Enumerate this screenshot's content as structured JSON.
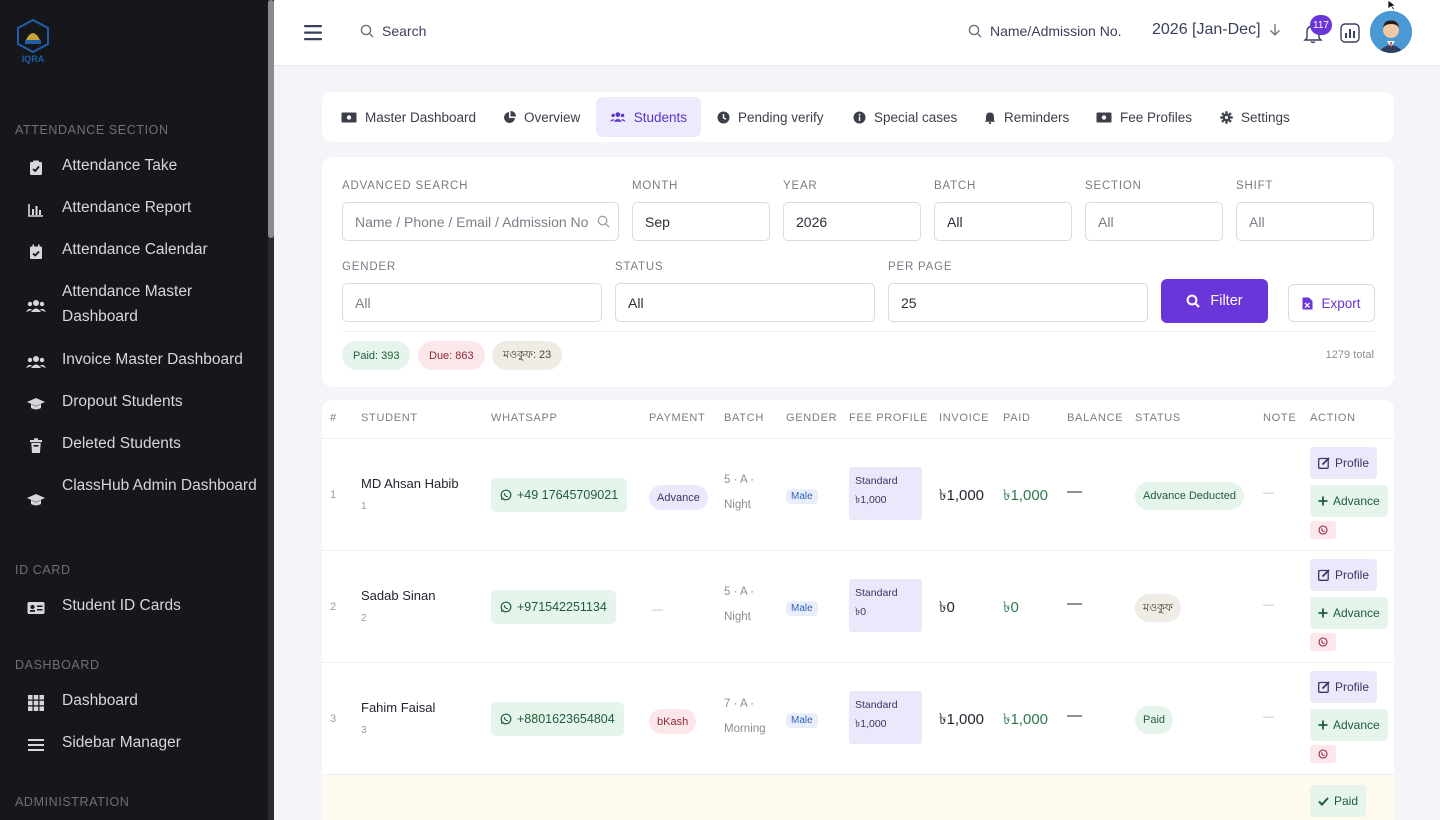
{
  "sidebar": {
    "logo_text": "IQRA",
    "sections": [
      {
        "title": "ATTENDANCE SECTION"
      },
      {
        "title": "ID CARD"
      },
      {
        "title": "DASHBOARD"
      },
      {
        "title": "ADMINISTRATION"
      }
    ],
    "items": [
      {
        "label": "Attendance Take",
        "icon": "clipboard-check-icon"
      },
      {
        "label": "Attendance Report",
        "icon": "bar-chart-icon"
      },
      {
        "label": "Attendance Calendar",
        "icon": "calendar-check-icon"
      },
      {
        "label": "Attendance Master Dashboard",
        "icon": "users-icon"
      },
      {
        "label": "Invoice Master Dashboard",
        "icon": "users-icon"
      },
      {
        "label": "Dropout Students",
        "icon": "graduation-cap-icon"
      },
      {
        "label": "Deleted Students",
        "icon": "trash-icon"
      },
      {
        "label": "ClassHub Admin Dashboard",
        "icon": "graduation-cap-icon"
      },
      {
        "label": "Student ID Cards",
        "icon": "id-card-icon"
      },
      {
        "label": "Dashboard",
        "icon": "grid-icon"
      },
      {
        "label": "Sidebar Manager",
        "icon": "list-icon"
      }
    ]
  },
  "header": {
    "search_label": "Search",
    "name_search_label": "Name/Admission No.",
    "year": "2026 [Jan-Dec]",
    "notification_count": "117"
  },
  "tabs": [
    {
      "label": "Master Dashboard",
      "icon": "money-icon"
    },
    {
      "label": "Overview",
      "icon": "pie-chart-icon"
    },
    {
      "label": "Students",
      "icon": "users-icon",
      "active": true
    },
    {
      "label": "Pending verify",
      "icon": "clock-icon"
    },
    {
      "label": "Special cases",
      "icon": "info-icon"
    },
    {
      "label": "Reminders",
      "icon": "bell-icon"
    },
    {
      "label": "Fee Profiles",
      "icon": "money-icon"
    },
    {
      "label": "Settings",
      "icon": "gear-icon"
    }
  ],
  "filters": {
    "advanced_search_label": "ADVANCED SEARCH",
    "advanced_search_placeholder": "Name / Phone / Email / Admission No",
    "month_label": "MONTH",
    "month": "Sep",
    "year_label": "YEAR",
    "year": "2026",
    "batch_label": "BATCH",
    "batch": "All",
    "section_label": "SECTION",
    "section": "All",
    "shift_label": "SHIFT",
    "shift": "All",
    "gender_label": "GENDER",
    "gender": "All",
    "status_label": "STATUS",
    "status": "All",
    "per_page_label": "PER PAGE",
    "per_page": "25",
    "filter_button": "Filter",
    "export_button": "Export",
    "pills": {
      "paid": "Paid: 393",
      "due": "Due: 863",
      "waived": "মওকুফ: 23"
    },
    "total": "1279 total"
  },
  "table": {
    "headers": [
      "#",
      "STUDENT",
      "WHATSAPP",
      "PAYMENT",
      "BATCH",
      "GENDER",
      "FEE PROFILE",
      "INVOICE",
      "PAID",
      "BALANCE",
      "STATUS",
      "NOTE",
      "ACTION"
    ],
    "rows": [
      {
        "num": "1",
        "name": "MD Ahsan Habib",
        "id": "1",
        "whatsapp": "+49 17645709021",
        "payment": "Advance",
        "batch1": "5 · A ·",
        "batch2": "Night",
        "gender": "Male",
        "fee1": "Standard",
        "fee2": "৳1,000",
        "invoice": "৳1,000",
        "paid": "৳1,000",
        "balance": "—",
        "status": "Advance Deducted",
        "note": "—"
      },
      {
        "num": "2",
        "name": "Sadab Sinan",
        "id": "2",
        "whatsapp": "+971542251134",
        "payment": "—",
        "batch1": "5 · A ·",
        "batch2": "Night",
        "gender": "Male",
        "fee1": "Standard",
        "fee2": "৳0",
        "invoice": "৳0",
        "paid": "৳0",
        "balance": "—",
        "status": "মওকুফ",
        "note": "—"
      },
      {
        "num": "3",
        "name": "Fahim Faisal",
        "id": "3",
        "whatsapp": "+8801623654804",
        "payment": "bKash",
        "batch1": "7 · A ·",
        "batch2": "Morning",
        "gender": "Male",
        "fee1": "Standard",
        "fee2": "৳1,000",
        "invoice": "৳1,000",
        "paid": "৳1,000",
        "balance": "—",
        "status": "Paid",
        "note": "—"
      }
    ],
    "action_profile": "Profile",
    "action_advance": "Advance",
    "action_paid": "Paid"
  },
  "colors": {
    "accent": "#6a35d9",
    "sidebar_bg": "#16171b",
    "paid_green": "#e6f5ec",
    "due_red": "#fbe7ea"
  }
}
